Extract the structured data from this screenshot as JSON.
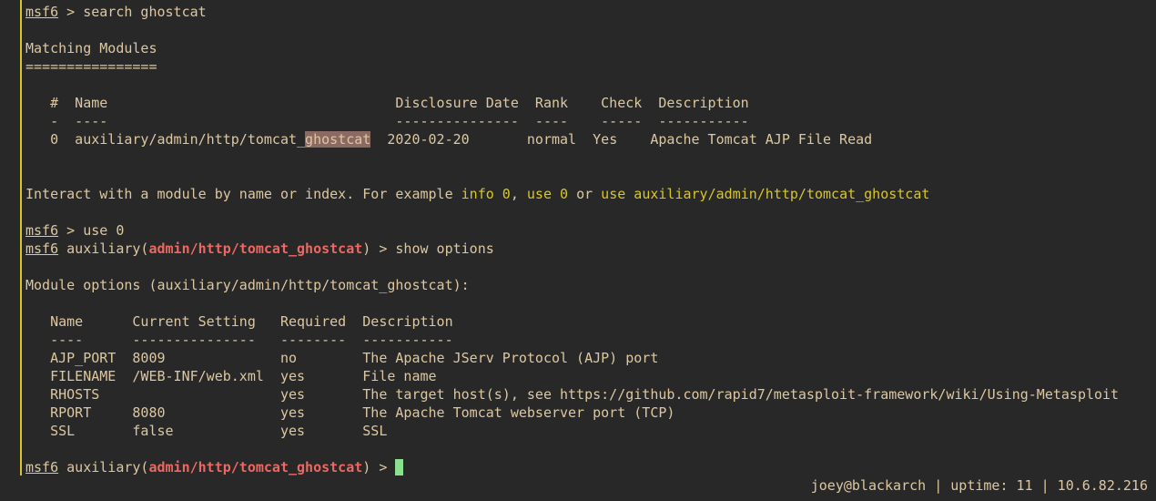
{
  "terminal": {
    "prompt": "msf6",
    "search_cmd": " > search ghostcat",
    "matching_title": "Matching Modules",
    "matching_rule": "================",
    "search_table": {
      "header": "   #  Name                                   Disclosure Date  Rank    Check  Description",
      "sep": "   -  ----                                   ---------------  ----    -----  -----------",
      "row_pre": "   0  auxiliary/admin/http/tomcat_",
      "row_hl": "ghostcat",
      "row_post": "  2020-02-20       normal  Yes    Apache Tomcat AJP File Read"
    },
    "interact": {
      "t1": "Interact with a module by name or index. For example ",
      "k1": "info 0",
      "t2": ", ",
      "k2": "use 0",
      "t3": " or ",
      "k3": "use auxiliary/admin/http/tomcat_ghostcat"
    },
    "use_cmd": " > use 0",
    "aux_open": " auxiliary(",
    "module_path": "admin/http/tomcat_ghostcat",
    "aux_close": ")",
    "show_cmd": " > show options",
    "final_tail": " > ",
    "options_title": "Module options (auxiliary/admin/http/tomcat_ghostcat):",
    "options_table": {
      "header": "   Name      Current Setting   Required  Description",
      "sep": "   ----      ---------------   --------  -----------",
      "rows": [
        "   AJP_PORT  8009              no        The Apache JServ Protocol (AJP) port",
        "   FILENAME  /WEB-INF/web.xml  yes       File name",
        "   RHOSTS                      yes       The target host(s), see https://github.com/rapid7/metasploit-framework/wiki/Using-Metasploit",
        "   RPORT     8080              yes       The Apache Tomcat webserver port (TCP)",
        "   SSL       false             yes       SSL"
      ]
    }
  },
  "statusbar": {
    "text": "joey@blackarch | uptime: 11 | 10.6.82.216"
  },
  "colors": {
    "background": "#282828",
    "foreground": "#ddc7a1",
    "module_red": "#ea6962",
    "keyword_yellow": "#d8c52a",
    "cursor_green": "#89e08e",
    "search_highlight": "#8a6a63"
  }
}
